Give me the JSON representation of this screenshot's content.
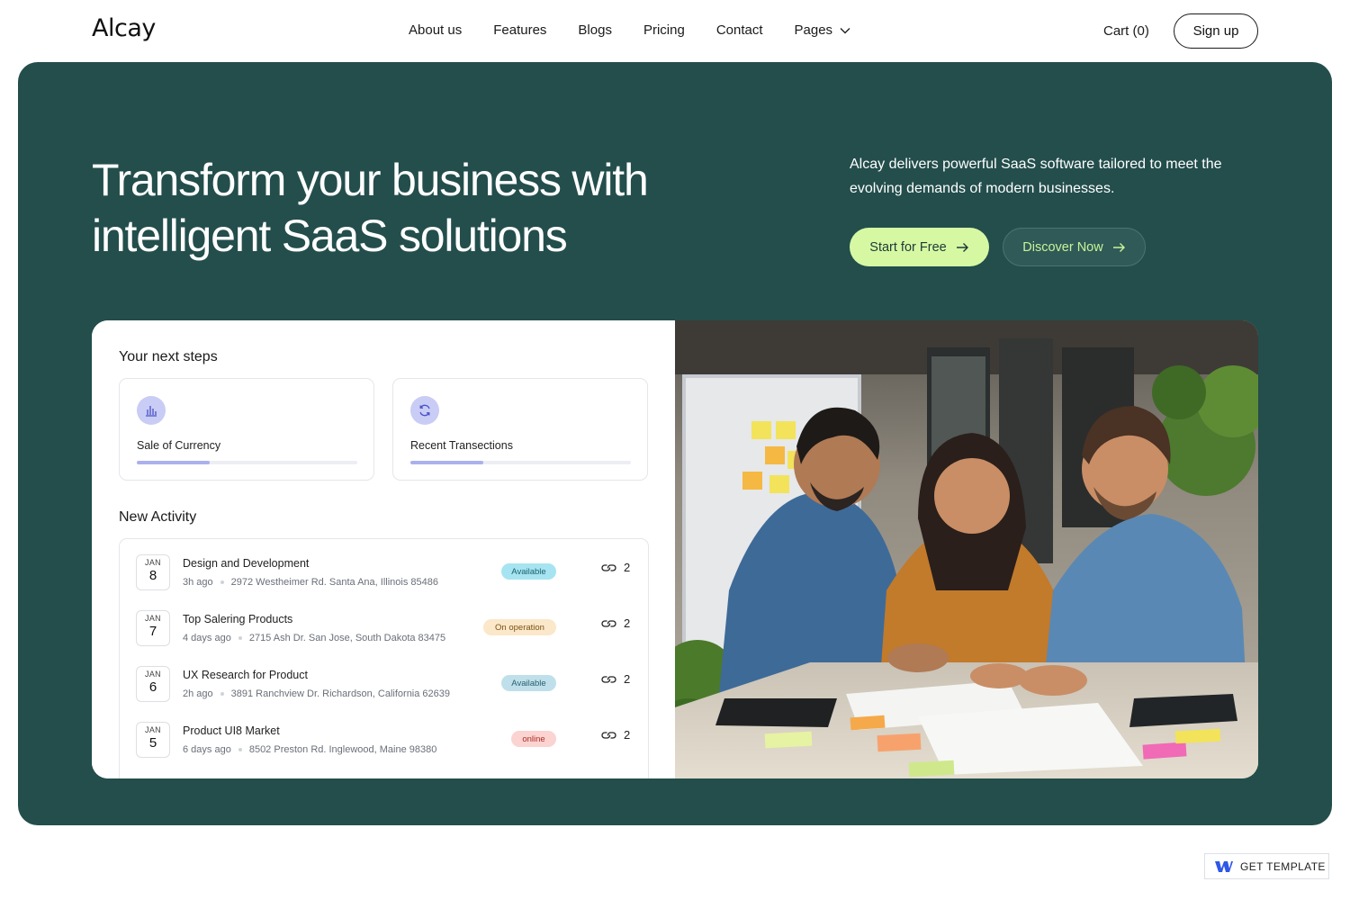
{
  "nav": {
    "logo": "Alcay",
    "links": [
      "About us",
      "Features",
      "Blogs",
      "Pricing",
      "Contact",
      "Pages"
    ],
    "pages_dropdown_icon": "chevron-down-icon",
    "cart": "Cart (0)",
    "signup": "Sign up"
  },
  "hero": {
    "headline_line1": "Transform your business with",
    "headline_line2": "intelligent SaaS solutions",
    "description": "Alcay delivers powerful SaaS software tailored to meet the evolving demands of modern businesses.",
    "primary_button": "Start for Free",
    "secondary_button": "Discover Now",
    "button_icon": "arrow-right-icon",
    "background_color": "#234e4c",
    "accent_color": "#d7f8a3"
  },
  "dashboard": {
    "next_steps_title": "Your next steps",
    "steps": [
      {
        "label": "Sale of Currency",
        "icon": "bar-chart-icon",
        "progress": 0.33
      },
      {
        "label": "Recent Transections",
        "icon": "refresh-icon",
        "progress": 0.33
      }
    ],
    "activity_title": "New Activity",
    "activities": [
      {
        "month": "JAN",
        "day": "8",
        "title": "Design and Development",
        "time": "3h ago",
        "address": "2972 Westheimer Rd. Santa Ana, Illinois 85486",
        "status": "Available",
        "status_bg": "#a6e4f1",
        "status_fg": "#1d5f6e",
        "links": "2"
      },
      {
        "month": "JAN",
        "day": "7",
        "title": "Top Salering Products",
        "time": "4 days ago",
        "address": "2715 Ash Dr. San Jose, South Dakota 83475",
        "status": "On operation",
        "status_bg": "#fbe7c9",
        "status_fg": "#7a5316",
        "links": "2"
      },
      {
        "month": "JAN",
        "day": "6",
        "title": "UX Research for Product",
        "time": "2h ago",
        "address": "3891 Ranchview Dr. Richardson, California 62639",
        "status": "Available",
        "status_bg": "#bfe0ea",
        "status_fg": "#2a5f70",
        "links": "2"
      },
      {
        "month": "JAN",
        "day": "5",
        "title": "Product UI8 Market",
        "time": "6 days ago",
        "address": "8502 Preston Rd. Inglewood, Maine 98380",
        "status": "online",
        "status_bg": "#fbd3d1",
        "status_fg": "#a8302a",
        "links": "2"
      }
    ],
    "link_icon": "link-icon",
    "photo": "team-collaboration-photo"
  },
  "badge": {
    "label": "GET TEMPLATE",
    "icon": "webflow-icon"
  }
}
